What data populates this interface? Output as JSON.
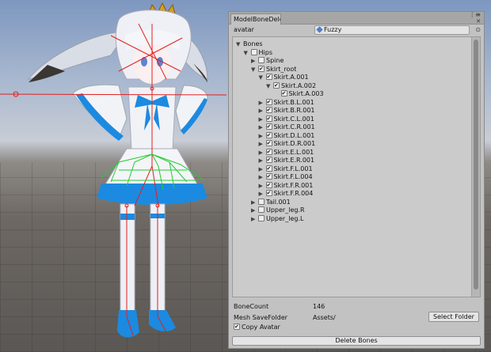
{
  "window": {
    "tab_title": "ModelBoneDele",
    "menu_glyph": "⋮≡",
    "close_glyph": "✕"
  },
  "avatar": {
    "label": "avatar",
    "value": "Fuzzy",
    "picker_glyph": "⊙"
  },
  "tree": {
    "rows": [
      {
        "label": "Bones",
        "depth": 0,
        "arrow": "▼",
        "checkbox": false
      },
      {
        "label": "Hips",
        "depth": 1,
        "arrow": "▼",
        "checkbox": true,
        "checked": false
      },
      {
        "label": "Spine",
        "depth": 2,
        "arrow": "▶",
        "checkbox": true,
        "checked": false
      },
      {
        "label": "Skirt_root",
        "depth": 2,
        "arrow": "▼",
        "checkbox": true,
        "checked": true
      },
      {
        "label": "Skirt.A.001",
        "depth": 3,
        "arrow": "▼",
        "checkbox": true,
        "checked": true
      },
      {
        "label": "Skirt.A.002",
        "depth": 4,
        "arrow": "▼",
        "checkbox": true,
        "checked": true
      },
      {
        "label": "Skirt.A.003",
        "depth": 5,
        "arrow": "",
        "checkbox": true,
        "checked": true
      },
      {
        "label": "Skirt.B.L.001",
        "depth": 3,
        "arrow": "▶",
        "checkbox": true,
        "checked": true
      },
      {
        "label": "Skirt.B.R.001",
        "depth": 3,
        "arrow": "▶",
        "checkbox": true,
        "checked": true
      },
      {
        "label": "Skirt.C.L.001",
        "depth": 3,
        "arrow": "▶",
        "checkbox": true,
        "checked": true
      },
      {
        "label": "Skirt.C.R.001",
        "depth": 3,
        "arrow": "▶",
        "checkbox": true,
        "checked": true
      },
      {
        "label": "Skirt.D.L.001",
        "depth": 3,
        "arrow": "▶",
        "checkbox": true,
        "checked": true
      },
      {
        "label": "Skirt.D.R.001",
        "depth": 3,
        "arrow": "▶",
        "checkbox": true,
        "checked": true
      },
      {
        "label": "Skirt.E.L.001",
        "depth": 3,
        "arrow": "▶",
        "checkbox": true,
        "checked": true
      },
      {
        "label": "Skirt.E.R.001",
        "depth": 3,
        "arrow": "▶",
        "checkbox": true,
        "checked": true
      },
      {
        "label": "Skirt.F.L.001",
        "depth": 3,
        "arrow": "▶",
        "checkbox": true,
        "checked": true
      },
      {
        "label": "Skirt.F.L.004",
        "depth": 3,
        "arrow": "▶",
        "checkbox": true,
        "checked": true
      },
      {
        "label": "Skirt.F.R.001",
        "depth": 3,
        "arrow": "▶",
        "checkbox": true,
        "checked": true
      },
      {
        "label": "Skirt.F.R.004",
        "depth": 3,
        "arrow": "▶",
        "checkbox": true,
        "checked": true
      },
      {
        "label": "Tail.001",
        "depth": 2,
        "arrow": "▶",
        "checkbox": true,
        "checked": false
      },
      {
        "label": "Upper_leg.R",
        "depth": 2,
        "arrow": "▶",
        "checkbox": true,
        "checked": false
      },
      {
        "label": "Upper_leg.L",
        "depth": 2,
        "arrow": "▶",
        "checkbox": true,
        "checked": false
      }
    ]
  },
  "info": {
    "bonecount_label": "BoneCount",
    "bonecount_value": "146",
    "savefolder_label": "Mesh SaveFolder",
    "savefolder_value": "Assets/",
    "select_folder_label": "Select Folder",
    "copy_avatar_label": "Copy Avatar",
    "copy_avatar_checked": true,
    "delete_label": "Delete Bones"
  },
  "colors": {
    "window_bg": "#c2c2c2",
    "object_icon": "#4f7fc4",
    "skeleton_red": "#e02020",
    "skeleton_green": "#22cc33",
    "dress_blue": "#1c8ae0"
  }
}
